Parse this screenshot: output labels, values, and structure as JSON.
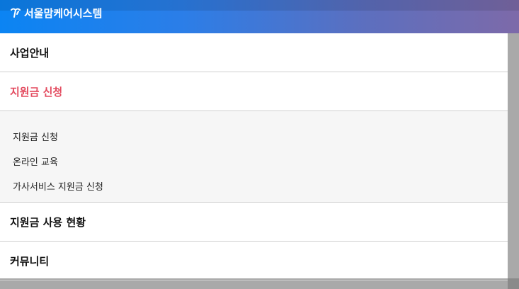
{
  "brand": {
    "logo_icon": "seoul-mom-care-logo-icon",
    "name": "서울맘케어시스템"
  },
  "menu": {
    "items": [
      {
        "label": "사업안내",
        "state": "collapsed"
      },
      {
        "label": "지원금 신청",
        "state": "expanded",
        "active": true,
        "color": "#e34b5f"
      },
      {
        "label": "지원금 사용 현황",
        "state": "collapsed"
      },
      {
        "label": "커뮤니티",
        "state": "collapsed"
      }
    ],
    "submenu": {
      "items": [
        {
          "label": "지원금 신청"
        },
        {
          "label": "온라인 교육"
        },
        {
          "label": "가사서비스 지원금 신청"
        }
      ]
    }
  },
  "colors": {
    "header_gradient_start": "#0b84f3",
    "header_gradient_end": "#7d6aa9",
    "active_menu": "#e34b5f",
    "divider": "#cfcfcf",
    "submenu_bg": "#f6f6f6",
    "overlay": "#cfcfcf"
  }
}
